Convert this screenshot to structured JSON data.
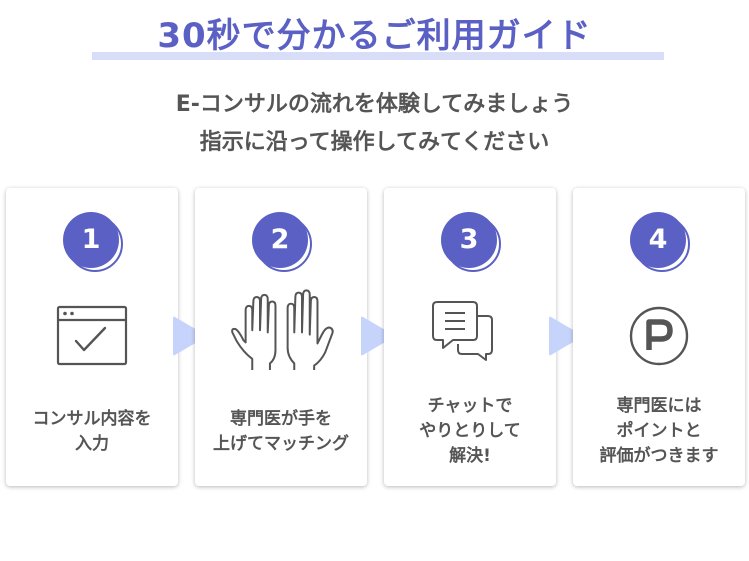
{
  "header": {
    "title": "30秒で分かるご利用ガイド",
    "subtitle_line1": "E-コンサルの流れを体験してみましょう",
    "subtitle_line2": "指示に沿って操作してみてください"
  },
  "colors": {
    "accent": "#5b61c4",
    "underline": "#d9def8",
    "arrow": "#c6d4fb",
    "text": "#555555"
  },
  "steps": [
    {
      "number": "1",
      "icon": "browser-check-icon",
      "lines": [
        "コンサル内容を",
        "入力"
      ]
    },
    {
      "number": "2",
      "icon": "raised-hands-icon",
      "lines": [
        "専門医が手を",
        "上げてマッチング"
      ]
    },
    {
      "number": "3",
      "icon": "chat-bubbles-icon",
      "lines": [
        "チャットで",
        "やりとりして",
        "解決!"
      ]
    },
    {
      "number": "4",
      "icon": "point-p-icon",
      "lines": [
        "専門医には",
        "ポイントと",
        "評価がつきます"
      ]
    }
  ]
}
